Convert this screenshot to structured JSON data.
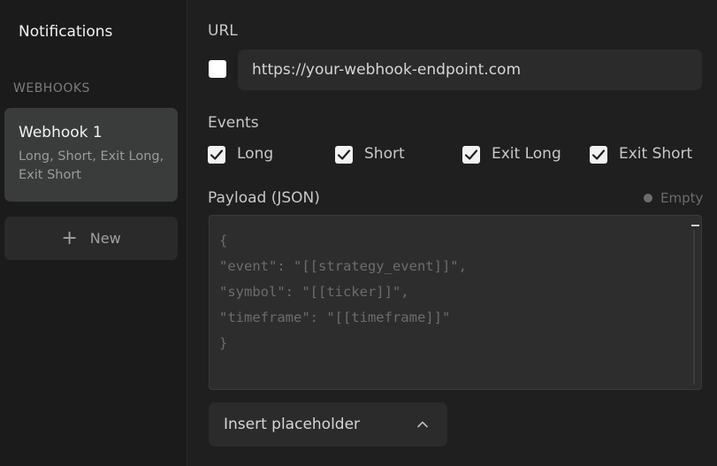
{
  "sidebar": {
    "title": "Notifications",
    "section_label": "WEBHOOKS",
    "webhooks": [
      {
        "name": "Webhook 1",
        "events": "Long, Short, Exit Long, Exit Short"
      }
    ],
    "new_label": "New"
  },
  "form": {
    "url_label": "URL",
    "url_enabled": false,
    "url_value": "https://your-webhook-endpoint.com",
    "events_label": "Events",
    "events": [
      {
        "label": "Long",
        "checked": true
      },
      {
        "label": "Short",
        "checked": true
      },
      {
        "label": "Exit Long",
        "checked": true
      },
      {
        "label": "Exit Short",
        "checked": true
      }
    ],
    "payload_label": "Payload (JSON)",
    "payload_status": "Empty",
    "payload_text": "{\n\"event\": \"[[strategy_event]]\",\n\"symbol\": \"[[ticker]]\",\n\"timeframe\": \"[[timeframe]]\"\n}",
    "insert_placeholder_label": "Insert placeholder"
  },
  "icons": {
    "new": "plus-icon",
    "checkbox": "checkmark-icon",
    "dropdown": "chevron-up-icon",
    "status": "status-dot-icon"
  },
  "colors": {
    "background": "#1f1f1f",
    "sidebar": "#1b1b1b",
    "card_selected": "#3a3c3c",
    "input": "#2b2b2b"
  }
}
